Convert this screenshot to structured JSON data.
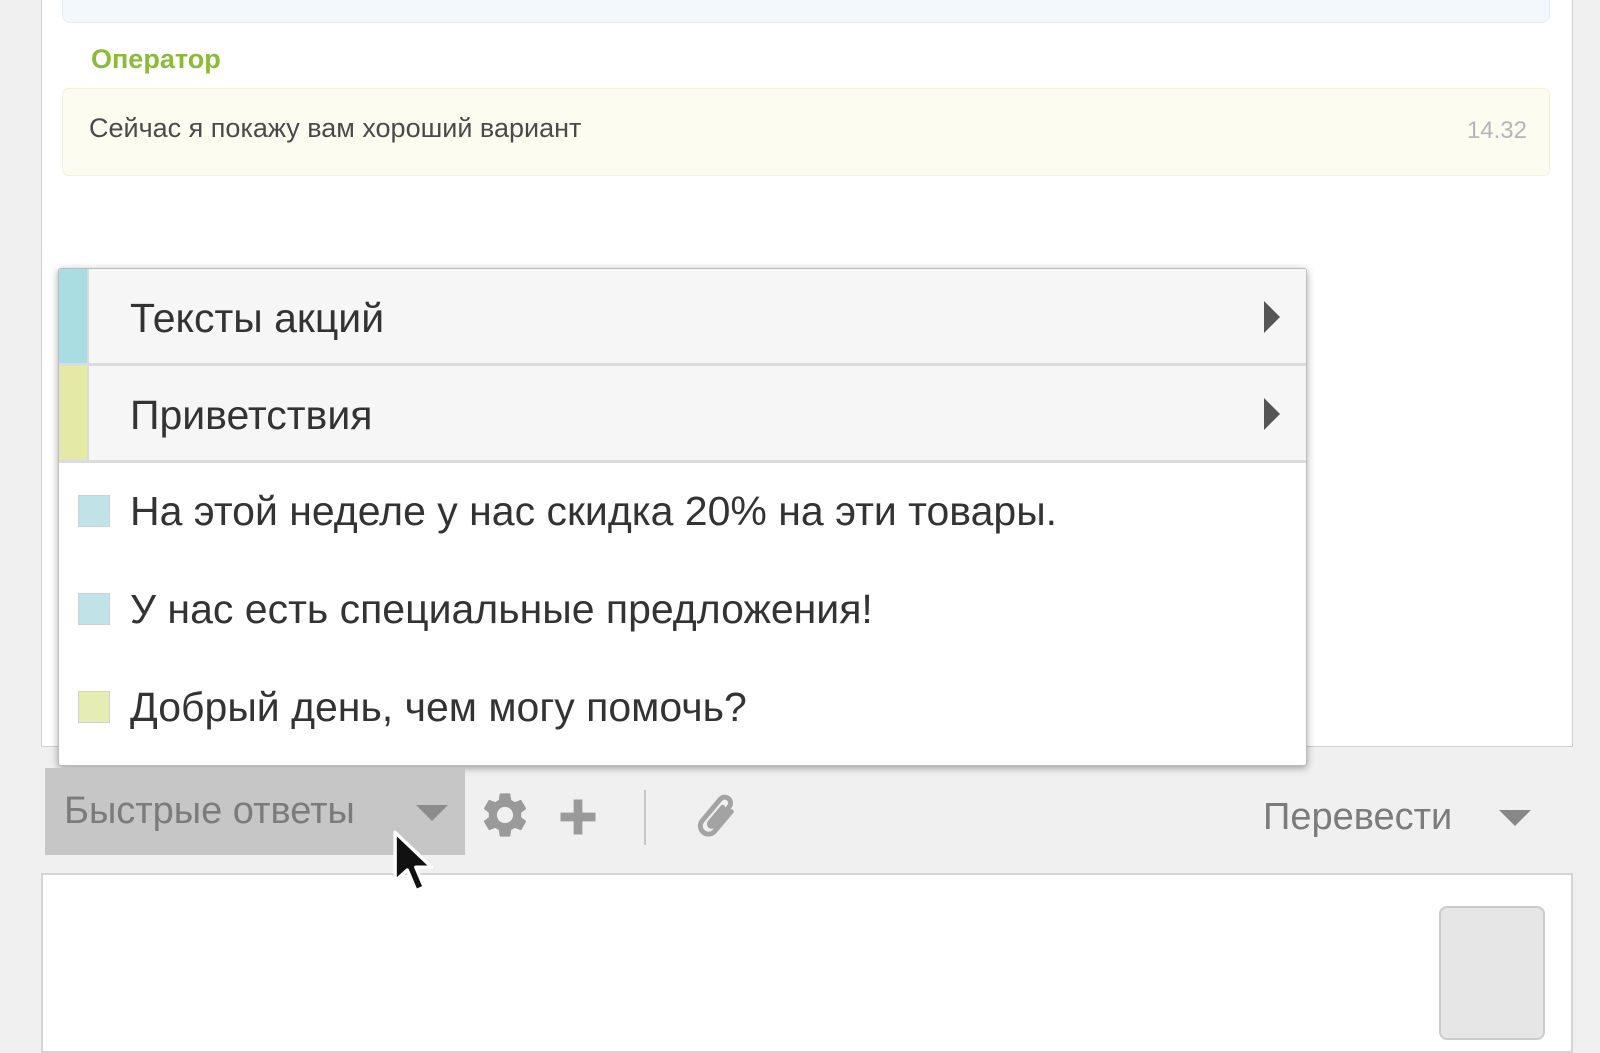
{
  "chat": {
    "author": "Оператор",
    "message": {
      "text": "Сейчас я покажу вам хороший вариант",
      "time": "14.32"
    }
  },
  "quick_replies_menu": {
    "categories": [
      {
        "label": "Тексты акций",
        "color": "#a9dde1"
      },
      {
        "label": "Приветствия",
        "color": "#e4eaa6"
      }
    ],
    "replies": [
      {
        "label": "На этой неделе у нас скидка 20% на эти товары.",
        "color": "#bfe3e6"
      },
      {
        "label": "У нас есть специальные предложения!",
        "color": "#bfe3e6"
      },
      {
        "label": "Добрый день, чем могу помочь?",
        "color": "#e6edb3"
      }
    ]
  },
  "toolbar": {
    "quick_replies_label": "Быстрые ответы",
    "translate_label": "Перевести",
    "icons": [
      "gear-icon",
      "plus-icon",
      "paperclip-icon"
    ]
  },
  "colors": {
    "author_accent": "#8cba3b",
    "operator_message_bg": "#fcfdf0",
    "button_active_bg": "#c6c6c6"
  }
}
